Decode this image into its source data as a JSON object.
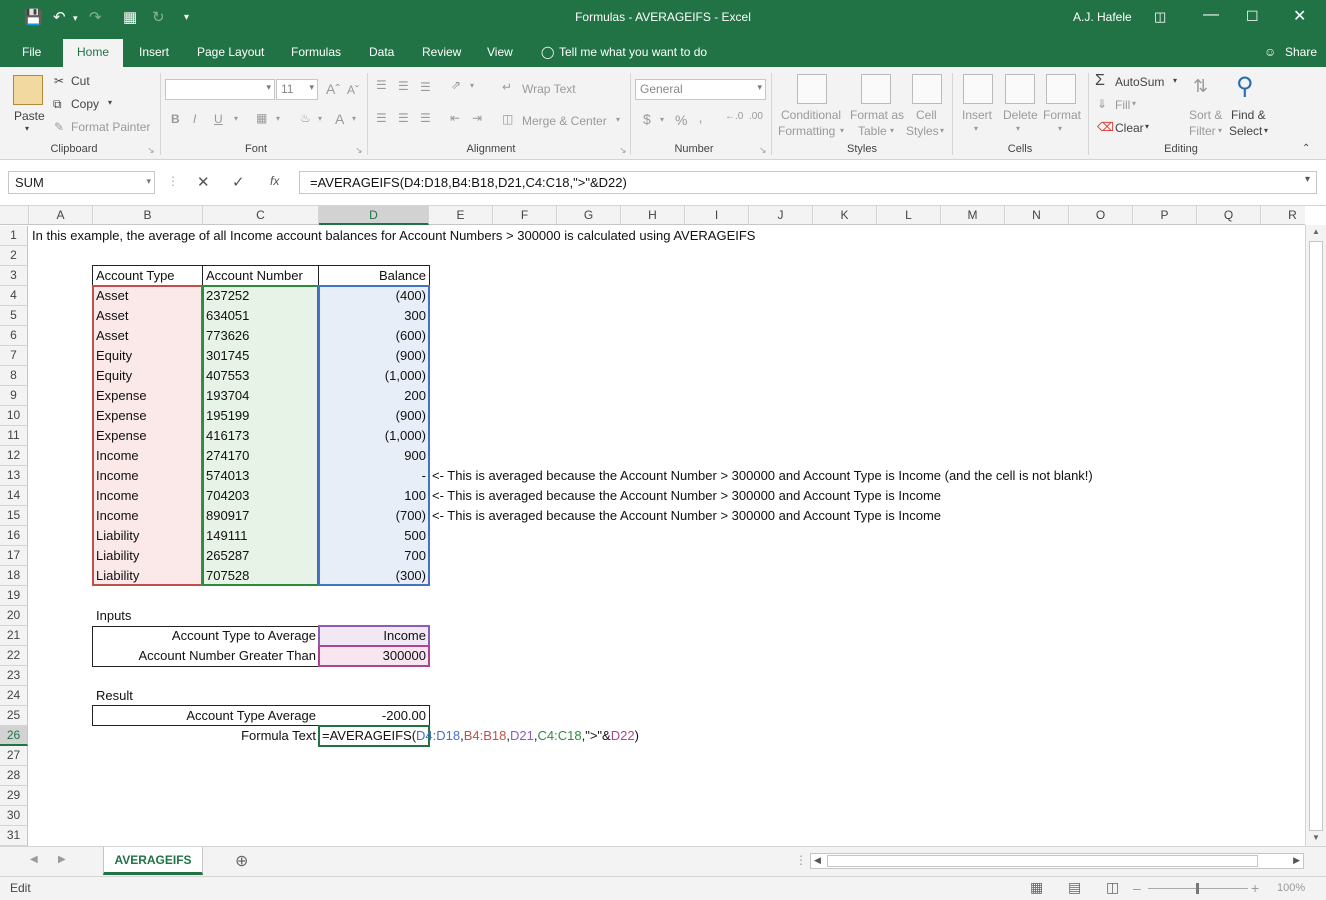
{
  "window": {
    "title": "Formulas - AVERAGEIFS  -  Excel",
    "user": "A.J. Hafele"
  },
  "tabs": [
    "File",
    "Home",
    "Insert",
    "Page Layout",
    "Formulas",
    "Data",
    "Review",
    "View"
  ],
  "tell_me": "Tell me what you want to do",
  "share": "Share",
  "ribbon": {
    "clipboard": {
      "label": "Clipboard",
      "paste": "Paste",
      "cut": "Cut",
      "copy": "Copy",
      "format_painter": "Format Painter"
    },
    "font": {
      "label": "Font",
      "size": "11"
    },
    "alignment": {
      "label": "Alignment",
      "wrap": "Wrap Text",
      "merge": "Merge & Center"
    },
    "number": {
      "label": "Number",
      "format": "General"
    },
    "styles": {
      "label": "Styles",
      "cond1": "Conditional",
      "cond2": "Formatting",
      "fmt1": "Format as",
      "fmt2": "Table",
      "cell1": "Cell",
      "cell2": "Styles"
    },
    "cells": {
      "label": "Cells",
      "insert": "Insert",
      "delete": "Delete",
      "format": "Format"
    },
    "editing": {
      "label": "Editing",
      "autosum": "AutoSum",
      "fill": "Fill",
      "clear": "Clear",
      "sort1": "Sort &",
      "sort2": "Filter",
      "find1": "Find &",
      "find2": "Select"
    }
  },
  "formula_bar": {
    "name_box": "SUM",
    "formula": "=AVERAGEIFS(D4:D18,B4:B18,D21,C4:C18,\">\"&D22)"
  },
  "columns": [
    "A",
    "B",
    "C",
    "D",
    "E",
    "F",
    "G",
    "H",
    "I",
    "J",
    "K",
    "L",
    "M",
    "N",
    "O",
    "P",
    "Q",
    "R"
  ],
  "rows": [
    "1",
    "2",
    "3",
    "4",
    "5",
    "6",
    "7",
    "8",
    "9",
    "10",
    "11",
    "12",
    "13",
    "14",
    "15",
    "16",
    "17",
    "18",
    "19",
    "20",
    "21",
    "22",
    "23",
    "24",
    "25",
    "26",
    "27",
    "28",
    "29",
    "30",
    "31"
  ],
  "sheet": {
    "intro": "In this example, the average of all Income account balances for Account Numbers > 300000 is calculated using AVERAGEIFS",
    "headers": {
      "type": "Account Type",
      "number": "Account Number",
      "balance": "Balance"
    },
    "records": [
      {
        "type": "Asset",
        "number": "237252",
        "balance": "(400)"
      },
      {
        "type": "Asset",
        "number": "634051",
        "balance": "300"
      },
      {
        "type": "Asset",
        "number": "773626",
        "balance": "(600)"
      },
      {
        "type": "Equity",
        "number": "301745",
        "balance": "(900)"
      },
      {
        "type": "Equity",
        "number": "407553",
        "balance": "(1,000)"
      },
      {
        "type": "Expense",
        "number": "193704",
        "balance": "200"
      },
      {
        "type": "Expense",
        "number": "195199",
        "balance": "(900)"
      },
      {
        "type": "Expense",
        "number": "416173",
        "balance": "(1,000)"
      },
      {
        "type": "Income",
        "number": "274170",
        "balance": "900"
      },
      {
        "type": "Income",
        "number": "574013",
        "balance": "-"
      },
      {
        "type": "Income",
        "number": "704203",
        "balance": "100"
      },
      {
        "type": "Income",
        "number": "890917",
        "balance": "(700)"
      },
      {
        "type": "Liability",
        "number": "149111",
        "balance": "500"
      },
      {
        "type": "Liability",
        "number": "265287",
        "balance": "700"
      },
      {
        "type": "Liability",
        "number": "707528",
        "balance": "(300)"
      }
    ],
    "notes": {
      "r13": "<- This is averaged because the Account Number > 300000 and  Account Type is Income (and the cell is not blank!)",
      "r14": "<- This is averaged because the Account Number > 300000 and  Account Type is Income",
      "r15": "<- This is averaged because the Account Number > 300000 and  Account Type is Income"
    },
    "inputs_title": "Inputs",
    "input_type_label": "Account Type to Average",
    "input_type_value": "Income",
    "input_num_label": "Account Number Greater Than",
    "input_num_value": "300000",
    "result_title": "Result",
    "result_label": "Account Type Average",
    "result_value": "-200.00",
    "formula_label": "Formula Text",
    "formula_parts": {
      "p0": "=AVERAGEIFS(",
      "p1": "D4:D18",
      ",1": ",",
      "p2": "B4:B18",
      "p3": "D21",
      "p4": "C4:C18",
      "p5": ",\">\"&",
      "p6": "D22",
      "p7": ")"
    }
  },
  "sheet_tab": "AVERAGEIFS",
  "status": {
    "mode": "Edit",
    "zoom": "100%"
  },
  "colors": {
    "excel_green": "#217346",
    "range_blue": "#4472c4",
    "range_red": "#c0504d",
    "range_green": "#2e8b3e",
    "range_purple": "#8e5bb5",
    "range_magenta": "#b0428f"
  }
}
